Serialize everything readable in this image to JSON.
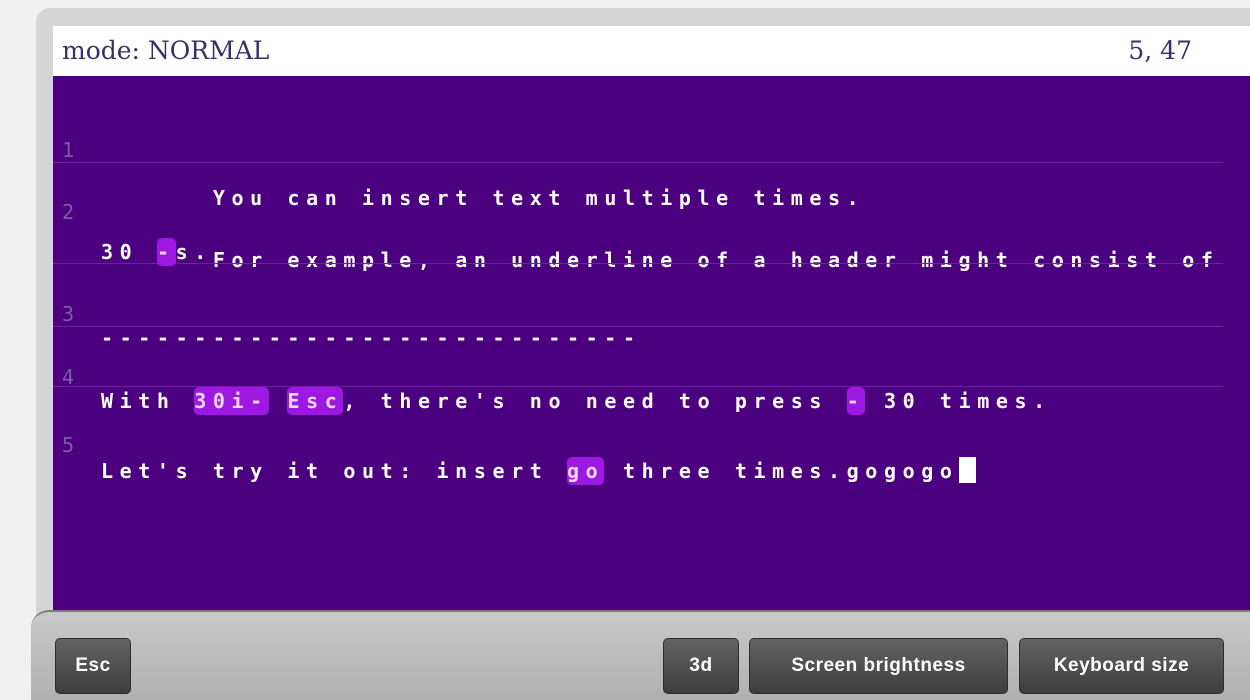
{
  "status": {
    "mode": "mode: NORMAL",
    "position": "5, 47"
  },
  "lines": [
    {
      "num": "1",
      "segments": [
        {
          "text": "You can insert text multiple times."
        }
      ]
    },
    {
      "num": "2",
      "segments": [
        {
          "text": "For example, an underline of a header might consist of"
        }
      ]
    },
    {
      "num": "",
      "segments": [
        {
          "text": "30 "
        },
        {
          "text": "-",
          "key": true
        },
        {
          "text": "s."
        }
      ]
    },
    {
      "num": "3",
      "segments": [
        {
          "text": "-----------------------------"
        }
      ]
    },
    {
      "num": "4",
      "segments": [
        {
          "text": "With "
        },
        {
          "text": "30i-",
          "key": true
        },
        {
          "text": " "
        },
        {
          "text": "Esc",
          "key": true
        },
        {
          "text": ", there's no need to press "
        },
        {
          "text": "-",
          "key": true
        },
        {
          "text": " 30 times."
        }
      ]
    },
    {
      "num": "5",
      "segments": [
        {
          "text": "Let's try it out: insert "
        },
        {
          "text": "go",
          "key": true
        },
        {
          "text": " three times.gogogo"
        }
      ]
    }
  ],
  "keyboard": {
    "esc": "Esc",
    "three_d": "3d",
    "brightness": "Screen brightness",
    "size": "Keyboard size"
  },
  "colors": {
    "editor_bg": "#4b0080",
    "key_highlight": "#9d19e3"
  }
}
